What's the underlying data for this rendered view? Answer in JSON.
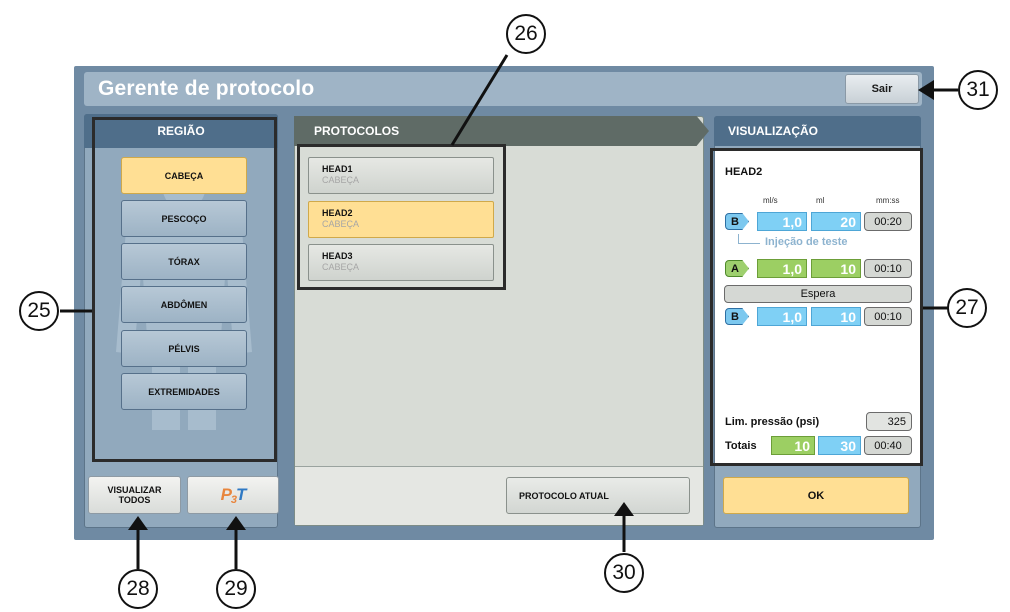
{
  "window": {
    "title": "Gerente de protocolo",
    "exit_label": "Sair"
  },
  "region": {
    "title": "REGIÃO",
    "items": [
      "CABEÇA",
      "PESCOÇO",
      "TÓRAX",
      "ABDÔMEN",
      "PÉLVIS",
      "EXTREMIDADES"
    ],
    "selected": "CABEÇA",
    "view_all_label": "VISUALIZAR\nTODOS",
    "p3t_logo": {
      "p": "P",
      "n": "3",
      "t": "T"
    }
  },
  "protocols": {
    "title": "PROTOCOLOS",
    "items": [
      {
        "name": "HEAD1",
        "region": "CABEÇA"
      },
      {
        "name": "HEAD2",
        "region": "CABEÇA"
      },
      {
        "name": "HEAD3",
        "region": "CABEÇA"
      }
    ],
    "selected": "HEAD2",
    "current_label": "PROTOCOLO ATUAL"
  },
  "visualization": {
    "title": "VISUALIZAÇÃO",
    "protocol_name": "HEAD2",
    "units": {
      "rate": "ml/s",
      "volume": "ml",
      "duration": "mm:ss"
    },
    "test_injection_label": "Injeção de teste",
    "phases": [
      {
        "syringe": "B",
        "rate": "1,0",
        "volume": "20",
        "duration": "00:20"
      },
      {
        "syringe": "A",
        "rate": "1,0",
        "volume": "10",
        "duration": "00:10"
      },
      {
        "syringe": "B",
        "rate": "1,0",
        "volume": "10",
        "duration": "00:10"
      }
    ],
    "pause_label": "Espera",
    "pressure_label": "Lim. pressão (psi)",
    "pressure_value": "325",
    "totals_label": "Totais",
    "totals": {
      "a": "10",
      "b": "30",
      "duration": "00:40"
    },
    "ok_label": "OK"
  },
  "callouts": [
    "25",
    "26",
    "27",
    "28",
    "29",
    "30",
    "31"
  ],
  "colors": {
    "selected": "#ffdf94",
    "syringe_a": "#9ccf63",
    "syringe_b": "#7fd0f5",
    "header": "#4f6e8a"
  }
}
